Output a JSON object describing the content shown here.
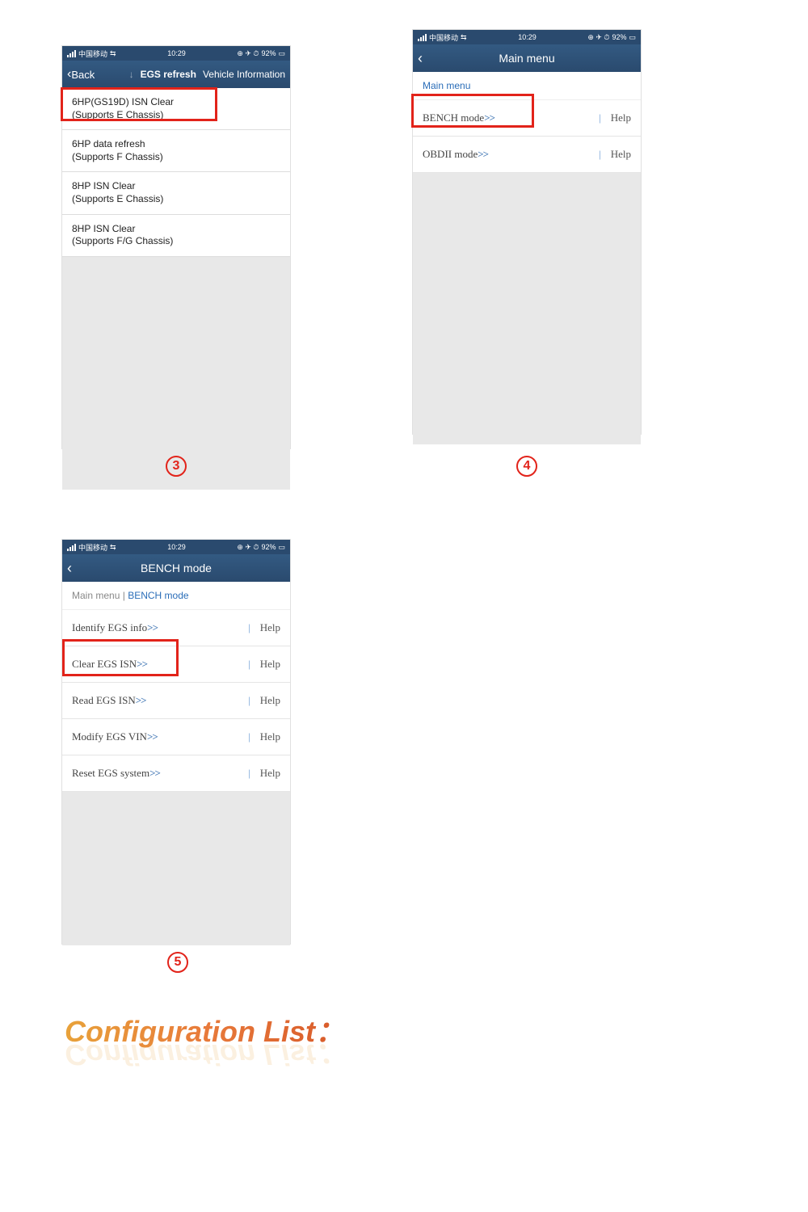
{
  "phone3": {
    "status": {
      "carrier": "中国移动",
      "time": "10:29",
      "battery": "92%"
    },
    "nav": {
      "back": "Back",
      "center": "EGS refresh",
      "right": "Vehicle Information"
    },
    "rows": [
      {
        "line1": "6HP(GS19D) ISN Clear",
        "line2": "(Supports E Chassis)"
      },
      {
        "line1": "6HP data refresh",
        "line2": "(Supports F Chassis)"
      },
      {
        "line1": "8HP ISN Clear",
        "line2": "(Supports E Chassis)"
      },
      {
        "line1": "8HP ISN Clear",
        "line2": "(Supports F/G Chassis)"
      }
    ],
    "step": "3"
  },
  "phone4": {
    "status": {
      "carrier": "中国移动",
      "time": "10:29",
      "battery": "92%"
    },
    "nav": {
      "title": "Main menu"
    },
    "breadcrumb": {
      "current": "Main menu"
    },
    "rows": [
      {
        "label": "BENCH mode",
        "help": "Help"
      },
      {
        "label": "OBDII mode",
        "help": "Help"
      }
    ],
    "step": "4"
  },
  "phone5": {
    "status": {
      "carrier": "中国移动",
      "time": "10:29",
      "battery": "92%"
    },
    "nav": {
      "title": "BENCH mode"
    },
    "breadcrumb": {
      "prev": "Main menu",
      "sep": "|",
      "current": "BENCH mode"
    },
    "rows": [
      {
        "label": "Identify EGS info",
        "help": "Help"
      },
      {
        "label": "Clear EGS ISN",
        "help": "Help"
      },
      {
        "label": "Read EGS ISN",
        "help": "Help"
      },
      {
        "label": "Modify EGS VIN",
        "help": "Help"
      },
      {
        "label": "Reset EGS system",
        "help": "Help"
      }
    ],
    "step": "5"
  },
  "footer": {
    "title": "Configuration List："
  },
  "arrows": ">>"
}
